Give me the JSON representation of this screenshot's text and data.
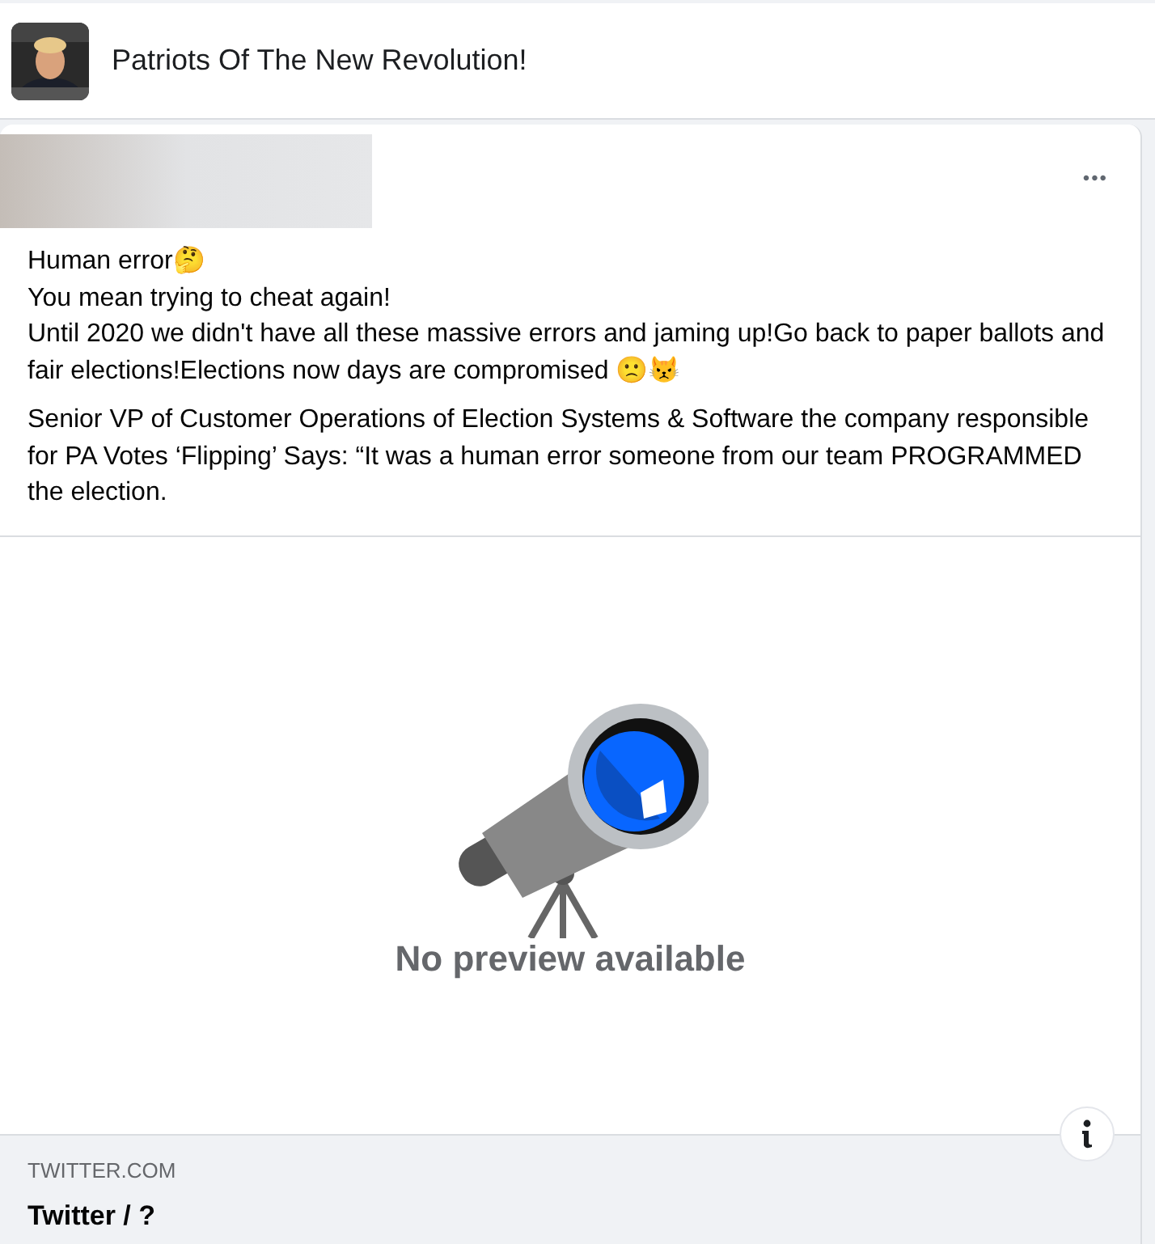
{
  "group": {
    "name": "Patriots Of The New Revolution!"
  },
  "post": {
    "more_button": "•••",
    "paragraphs": [
      "Human error🤔\nYou mean trying to cheat again!\nUntil 2020 we didn't have all these massive errors and jaming up!Go back to paper ballots and fair elections!Elections now days are compromised 🙁😾",
      "Senior VP of Customer Operations of Election Systems & Software the company responsible for PA Votes ‘Flipping’ Says: “It was a human error someone from our team PROGRAMMED the election."
    ],
    "preview": {
      "message": "No preview available",
      "domain": "TWITTER.COM",
      "title": "Twitter / ?"
    }
  }
}
